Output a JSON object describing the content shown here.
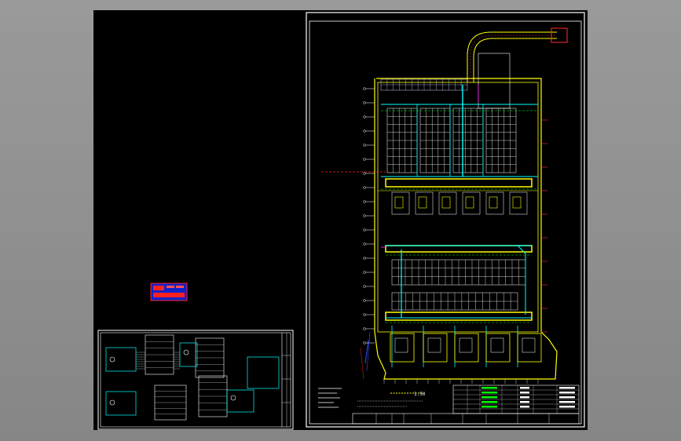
{
  "colors": {
    "canvas_bg": "#000000",
    "viewport_bg": "#8d8d8d",
    "frame": "#ffffff",
    "wall": "#ffff00",
    "pipe": "#00ffff",
    "green": "#00ff00",
    "magenta": "#ff00ff",
    "red": "#ff0000",
    "blue": "#3050ff",
    "legend_box": "#2030ff"
  },
  "drawing": {
    "scale_label": "1:50",
    "title_block_note": ""
  }
}
